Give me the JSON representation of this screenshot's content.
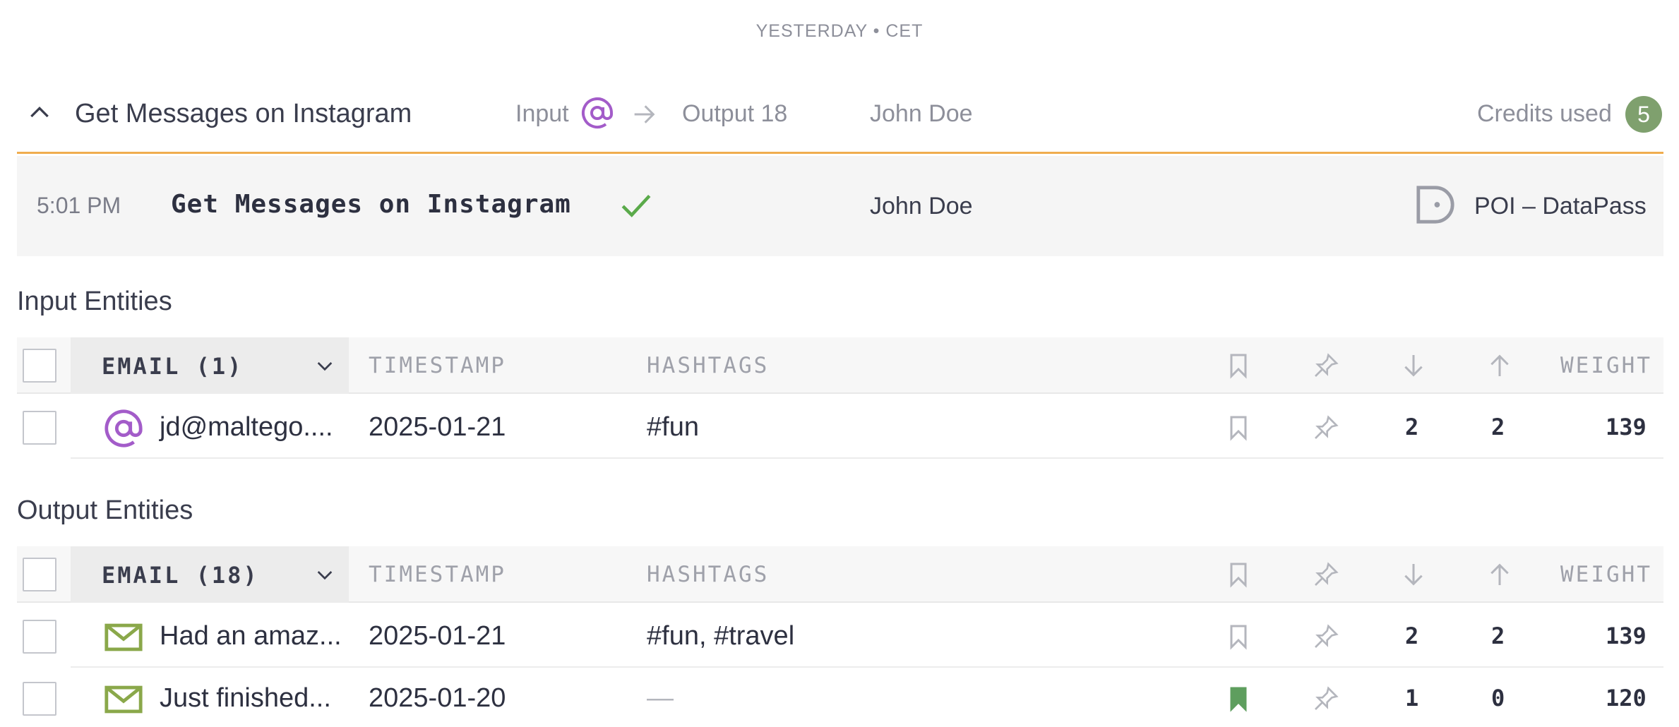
{
  "day_header": "YESTERDAY • CET",
  "run": {
    "title": "Get Messages on Instagram",
    "input_label": "Input",
    "output_label": "Output 18",
    "user": "John Doe",
    "credits_label": "Credits used",
    "credits_value": "5"
  },
  "transform": {
    "time": "5:01 PM",
    "name": "Get Messages on Instagram",
    "user": "John Doe",
    "poi": "POI – DataPass"
  },
  "input_section": {
    "title": "Input Entities",
    "columns": {
      "type": "EMAIL (1)",
      "timestamp": "TIMESTAMP",
      "hashtags": "HASHTAGS",
      "weight": "WEIGHT"
    },
    "rows": [
      {
        "name": "jd@maltego....",
        "timestamp": "2025-01-21",
        "hashtags": "#fun",
        "bookmarked": false,
        "down": "2",
        "up": "2",
        "weight": "139"
      }
    ]
  },
  "output_section": {
    "title": "Output Entities",
    "columns": {
      "type": "EMAIL (18)",
      "timestamp": "TIMESTAMP",
      "hashtags": "HASHTAGS",
      "weight": "WEIGHT"
    },
    "rows": [
      {
        "name": "Had an amaz...",
        "timestamp": "2025-01-21",
        "hashtags": "#fun, #travel",
        "bookmarked": false,
        "down": "2",
        "up": "2",
        "weight": "139"
      },
      {
        "name": "Just finished...",
        "timestamp": "2025-01-20",
        "hashtags": "—",
        "bookmarked": true,
        "down": "1",
        "up": "0",
        "weight": "120"
      }
    ]
  },
  "colors": {
    "accent_orange": "#f0ad4e",
    "credits_green": "#7fa06e",
    "at_purple": "#a35cc9",
    "mail_green": "#8aa84a",
    "check_green": "#5aaa4a",
    "bookmark_green": "#5e9e5e"
  },
  "icons": [
    "chevron-up-icon",
    "at-sign-icon",
    "arrow-right-icon",
    "check-icon",
    "poi-icon",
    "chevron-down-icon",
    "bookmark-icon",
    "pin-icon",
    "arrow-down-icon",
    "arrow-up-icon",
    "mail-icon"
  ]
}
